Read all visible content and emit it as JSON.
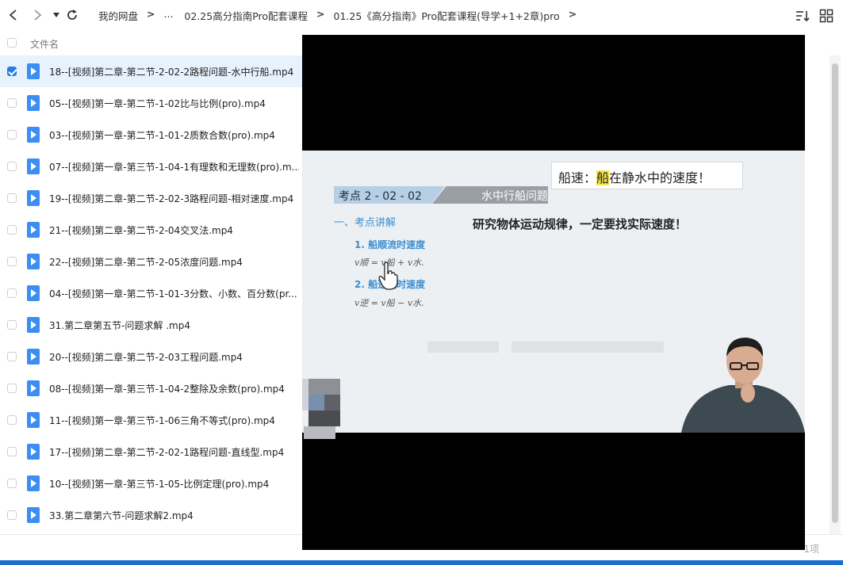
{
  "breadcrumb": [
    "我的网盘",
    "...",
    "02.25高分指南Pro配套课程",
    "01.25《高分指南》Pro配套课程(导学+1+2章)pro"
  ],
  "list_header": {
    "name_label": "文件名"
  },
  "files": [
    {
      "name": "18--[视频]第二章-第二节-2-02-2路程问题-水中行船.mp4",
      "selected": true
    },
    {
      "name": "05--[视频]第一章-第二节-1-02比与比例(pro).mp4",
      "selected": false
    },
    {
      "name": "03--[视频]第一章-第二节-1-01-2质数合数(pro).mp4",
      "selected": false
    },
    {
      "name": "07--[视频]第一章-第三节-1-04-1有理数和无理数(pro).m...",
      "selected": false
    },
    {
      "name": "19--[视频]第二章-第二节-2-02-3路程问题-相对速度.mp4",
      "selected": false
    },
    {
      "name": "21--[视频]第二章-第二节-2-04交叉法.mp4",
      "selected": false
    },
    {
      "name": "22--[视频]第二章-第二节-2-05浓度问题.mp4",
      "selected": false
    },
    {
      "name": "04--[视频]第一章-第二节-1-01-3分数、小数、百分数(pr...",
      "selected": false
    },
    {
      "name": "31.第二章第五节-问题求解 .mp4",
      "selected": false
    },
    {
      "name": "20--[视频]第二章-第二节-2-03工程问题.mp4",
      "selected": false
    },
    {
      "name": "08--[视频]第一章-第三节-1-04-2整除及余数(pro).mp4",
      "selected": false
    },
    {
      "name": "11--[视频]第一章-第三节-1-06三角不等式(pro).mp4",
      "selected": false
    },
    {
      "name": "17--[视频]第二章-第二节-2-02-1路程问题-直线型.mp4",
      "selected": false
    },
    {
      "name": "10--[视频]第一章-第三节-1-05-比例定理(pro).mp4",
      "selected": false
    },
    {
      "name": "33.第二章第六节-问题求解2.mp4",
      "selected": false
    }
  ],
  "footer": {
    "count_text": "1项"
  },
  "video": {
    "note_prefix": "船速：",
    "note_highlight": "船",
    "note_suffix": "在静水中的速度！",
    "kp_code": "考点 2 - 02 - 02",
    "kp_title": "水中行船问题",
    "section_title": "一、考点讲解",
    "big_text": "研究物体运动规律，一定要找实际速度！",
    "item1": "1. 船顺流时速度",
    "formula1": "v顺 = v船 + v水.",
    "item2": "2. 船逆流时速度",
    "formula2": "v逆 = v船 − v水."
  },
  "colors": {
    "accent": "#1f7fe9",
    "selected_row": "#e8f2fd",
    "file_icon": "#3c8ef3"
  }
}
